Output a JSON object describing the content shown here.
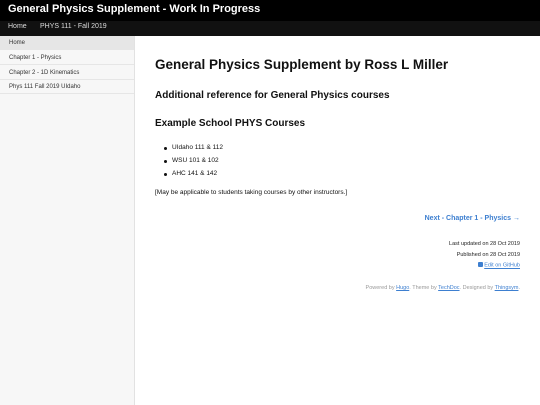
{
  "header": {
    "title": "General Physics Supplement - Work In Progress"
  },
  "nav": {
    "home": "Home",
    "course": "PHYS 111 - Fall 2019"
  },
  "sidebar": {
    "items": [
      {
        "label": "Home"
      },
      {
        "label": "Chapter 1 - Physics"
      },
      {
        "label": "Chapter 2 - 1D Kinematics"
      },
      {
        "label": "Phys 111 Fall 2019 UIdaho"
      }
    ]
  },
  "main": {
    "title": "General Physics Supplement by Ross L Miller",
    "subtitle": "Additional reference for General Physics courses",
    "section_heading": "Example School PHYS Courses",
    "courses": [
      "UIdaho 111 & 112",
      "WSU 101 & 102",
      "AHC 141 & 142"
    ],
    "note": "[May be applicable to students taking courses by other instructors.]",
    "next_link": "Next - Chapter 1 - Physics",
    "last_updated": "Last updated on 28 Oct 2019",
    "published": "Published on 28 Oct 2019",
    "edit_link": "Edit on GitHub"
  },
  "footer": {
    "powered_by": "Powered by",
    "hugo": "Hugo",
    "theme_by": ". Theme by",
    "techdoc": "TechDoc",
    "designed_by": ". Designed by",
    "thingsym": "Thingsym",
    "end": "."
  },
  "colors": {
    "topbar": "#000000",
    "navbar": "#111111",
    "link": "#3d7fd0",
    "sidebar": "#f7f7f7"
  },
  "icons": {
    "next_arrow": "arrow-right-icon",
    "edit": "edit-icon"
  }
}
